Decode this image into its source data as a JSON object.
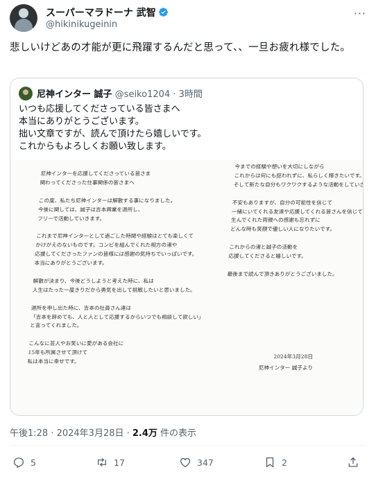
{
  "author": {
    "name": "スーパーマラドーナ 武智",
    "handle": "@hikinikugeinin"
  },
  "post_text": "悲しいけどあの才能が更に飛躍するんだと思って、、一旦お疲れ様でした。",
  "quote": {
    "name": "尼神インター 誠子",
    "handle": "@seiko1204",
    "time": "· 3時間",
    "text": "いつも応援してくださっている皆さまへ\n本当にありがとうございます。\n拙い文章ですが、読んで頂けたら嬉しいです。\nこれからもよろしくお願い致します。",
    "letter_left": "尼神インターを応援してくださっている皆さま\n関わってくださった仕事関係の皆さまへ\n\nこの度、私たち尼神インターは解散する事になりました。\n今後に関しては、誠子は吉本興業を退所し、\nフリーで活動していきます。\n\nこれまで尼神インターとして過ごした時間や経験はとても楽しくて\nかけがえのないものです。コンビを組んでくれた相方の渚や\n応援してくださったファンの皆様には感謝の気持ちでいっぱいです。\n本当にありがとうございます。\n\n解散が決まり、今後どうしようと考えた時に、私は\n人生はたった一度きりだから勇気を出して挑戦したいと思いました。\n\n退所を申し出た時に、吉本の社員さん達は\n「吉本を辞めても、人と人として応援するからいつでも相談して欲しい」\nと言ってくれました。\n\nこんなに芸人やお笑いに愛がある会社に\n15年も所属させて頂けて\n私は本当に幸せです。",
    "letter_right": "今までの経験や想いを大切にしながら\nこれからは何にも捉われずに、私らしく輝きたいです。\nそして新たな自分もワクワクするような活動をしていきます。\n\n不安もありますが、自分の可能性を信じて\n一緒にいてくれる友達や応援してくれる皆さんを信じて\n生んでくれた両親への感謝も忘れずに\nどんな時も笑顔で優しい人になりたいです。\n\nこれからの渚と誠子の活動を\n応援してくださると嬉しいです。\n\n最後まで読んで頂きありがとうございました。",
    "letter_date": "2024年3月28日",
    "letter_signature": "尼神インター 誠子より"
  },
  "meta": {
    "time": "午後1:28 · 2024年3月28日 · ",
    "views_count": "2.4万",
    "views_label": " 件の表示"
  },
  "actions": {
    "replies": "5",
    "reposts": "17",
    "likes": "347",
    "bookmarks": "2"
  },
  "colors": {
    "verified": "#1d9bf0",
    "secondary_text": "#536471",
    "border": "#cfd9de"
  }
}
